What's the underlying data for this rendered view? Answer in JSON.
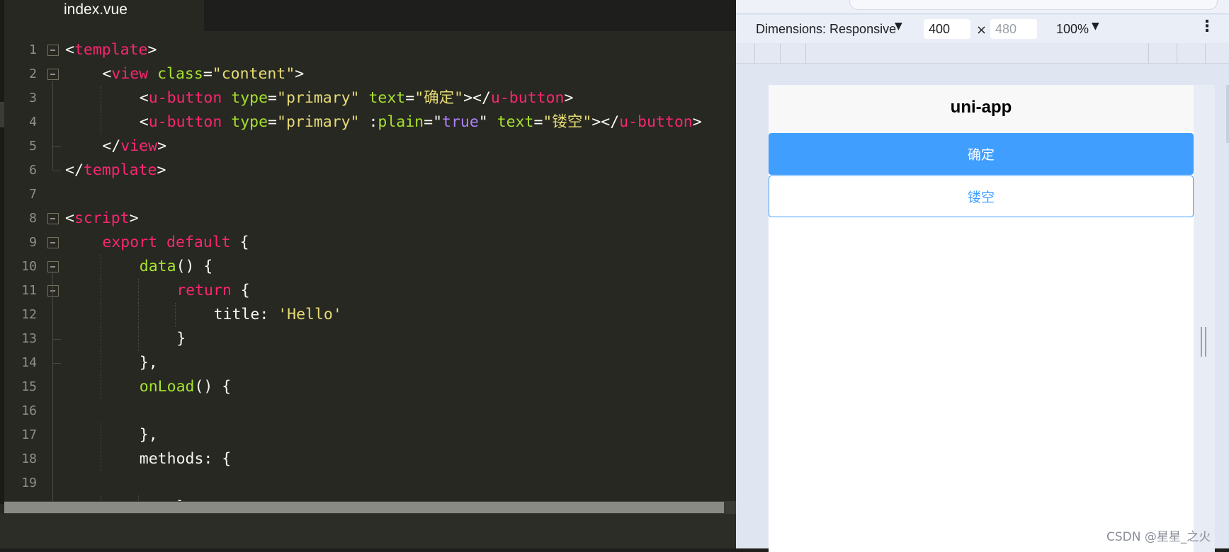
{
  "editor": {
    "tab_label": "index.vue",
    "lines": [
      {
        "n": "1",
        "indent": 0,
        "fold": true,
        "tokens": [
          [
            "c-pun",
            "<"
          ],
          [
            "c-tag",
            "template"
          ],
          [
            "c-pun",
            ">"
          ]
        ]
      },
      {
        "n": "2",
        "indent": 1,
        "fold": true,
        "tokens": [
          [
            "c-pun",
            "<"
          ],
          [
            "c-tag",
            "view"
          ],
          [
            "c-pun",
            " "
          ],
          [
            "c-attr",
            "class"
          ],
          [
            "c-pun",
            "="
          ],
          [
            "c-str",
            "\"content\""
          ],
          [
            "c-pun",
            ">"
          ]
        ]
      },
      {
        "n": "3",
        "indent": 2,
        "fold": false,
        "tokens": [
          [
            "c-pun",
            "<"
          ],
          [
            "c-tag",
            "u-button"
          ],
          [
            "c-pun",
            " "
          ],
          [
            "c-attr",
            "type"
          ],
          [
            "c-pun",
            "="
          ],
          [
            "c-str",
            "\"primary\""
          ],
          [
            "c-pun",
            " "
          ],
          [
            "c-attr",
            "text"
          ],
          [
            "c-pun",
            "="
          ],
          [
            "c-str",
            "\"确定\""
          ],
          [
            "c-pun",
            "></"
          ],
          [
            "c-tag",
            "u-button"
          ],
          [
            "c-pun",
            ">"
          ]
        ]
      },
      {
        "n": "4",
        "indent": 2,
        "fold": false,
        "tokens": [
          [
            "c-pun",
            "<"
          ],
          [
            "c-tag",
            "u-button"
          ],
          [
            "c-pun",
            " "
          ],
          [
            "c-attr",
            "type"
          ],
          [
            "c-pun",
            "="
          ],
          [
            "c-str",
            "\"primary\""
          ],
          [
            "c-pun",
            " :"
          ],
          [
            "c-attr",
            "plain"
          ],
          [
            "c-pun",
            "=\""
          ],
          [
            "c-const",
            "true"
          ],
          [
            "c-pun",
            "\" "
          ],
          [
            "c-attr",
            "text"
          ],
          [
            "c-pun",
            "="
          ],
          [
            "c-str",
            "\"镂空\""
          ],
          [
            "c-pun",
            "></"
          ],
          [
            "c-tag",
            "u-button"
          ],
          [
            "c-pun",
            ">"
          ]
        ]
      },
      {
        "n": "5",
        "indent": 1,
        "fold": false,
        "tokens": [
          [
            "c-pun",
            "</"
          ],
          [
            "c-tag",
            "view"
          ],
          [
            "c-pun",
            ">"
          ]
        ]
      },
      {
        "n": "6",
        "indent": 0,
        "fold": false,
        "tokens": [
          [
            "c-pun",
            "</"
          ],
          [
            "c-tag",
            "template"
          ],
          [
            "c-pun",
            ">"
          ]
        ]
      },
      {
        "n": "7",
        "indent": 0,
        "fold": false,
        "tokens": []
      },
      {
        "n": "8",
        "indent": 0,
        "fold": true,
        "tokens": [
          [
            "c-pun",
            "<"
          ],
          [
            "c-tag",
            "script"
          ],
          [
            "c-pun",
            ">"
          ]
        ]
      },
      {
        "n": "9",
        "indent": 1,
        "fold": true,
        "tokens": [
          [
            "c-kw",
            "export"
          ],
          [
            "c-pun",
            " "
          ],
          [
            "c-kw",
            "default"
          ],
          [
            "c-pun",
            " {"
          ]
        ]
      },
      {
        "n": "10",
        "indent": 2,
        "fold": true,
        "tokens": [
          [
            "c-fn",
            "data"
          ],
          [
            "c-pun",
            "() {"
          ]
        ]
      },
      {
        "n": "11",
        "indent": 3,
        "fold": true,
        "tokens": [
          [
            "c-kw",
            "return"
          ],
          [
            "c-pun",
            " {"
          ]
        ]
      },
      {
        "n": "12",
        "indent": 4,
        "fold": false,
        "tokens": [
          [
            "c-pun",
            "title: "
          ],
          [
            "c-str",
            "'Hello'"
          ]
        ]
      },
      {
        "n": "13",
        "indent": 3,
        "fold": false,
        "tokens": [
          [
            "c-pun",
            "}"
          ]
        ]
      },
      {
        "n": "14",
        "indent": 2,
        "fold": false,
        "tokens": [
          [
            "c-pun",
            "},"
          ]
        ]
      },
      {
        "n": "15",
        "indent": 2,
        "fold": false,
        "tokens": [
          [
            "c-fn",
            "onLoad"
          ],
          [
            "c-pun",
            "() {"
          ]
        ]
      },
      {
        "n": "16",
        "indent": 0,
        "fold": false,
        "tokens": []
      },
      {
        "n": "17",
        "indent": 2,
        "fold": false,
        "tokens": [
          [
            "c-pun",
            "},"
          ]
        ]
      },
      {
        "n": "18",
        "indent": 2,
        "fold": false,
        "tokens": [
          [
            "c-pun",
            "methods: {"
          ]
        ]
      },
      {
        "n": "19",
        "indent": 0,
        "fold": false,
        "tokens": []
      },
      {
        "n": "",
        "indent": 3,
        "fold": false,
        "tokens": [
          [
            "c-pun",
            "}"
          ]
        ]
      }
    ]
  },
  "devtools": {
    "dimensions_label": "Dimensions: Responsive",
    "width_value": "400",
    "times": "×",
    "height_placeholder": "480",
    "zoom": "100%",
    "more_icon": "⋮",
    "caret": "▼"
  },
  "preview": {
    "nav_title": "uni-app",
    "confirm_label": "确定",
    "hollow_label": "镂空",
    "primary_color": "#409eff"
  },
  "watermark": "CSDN @星星_之火"
}
